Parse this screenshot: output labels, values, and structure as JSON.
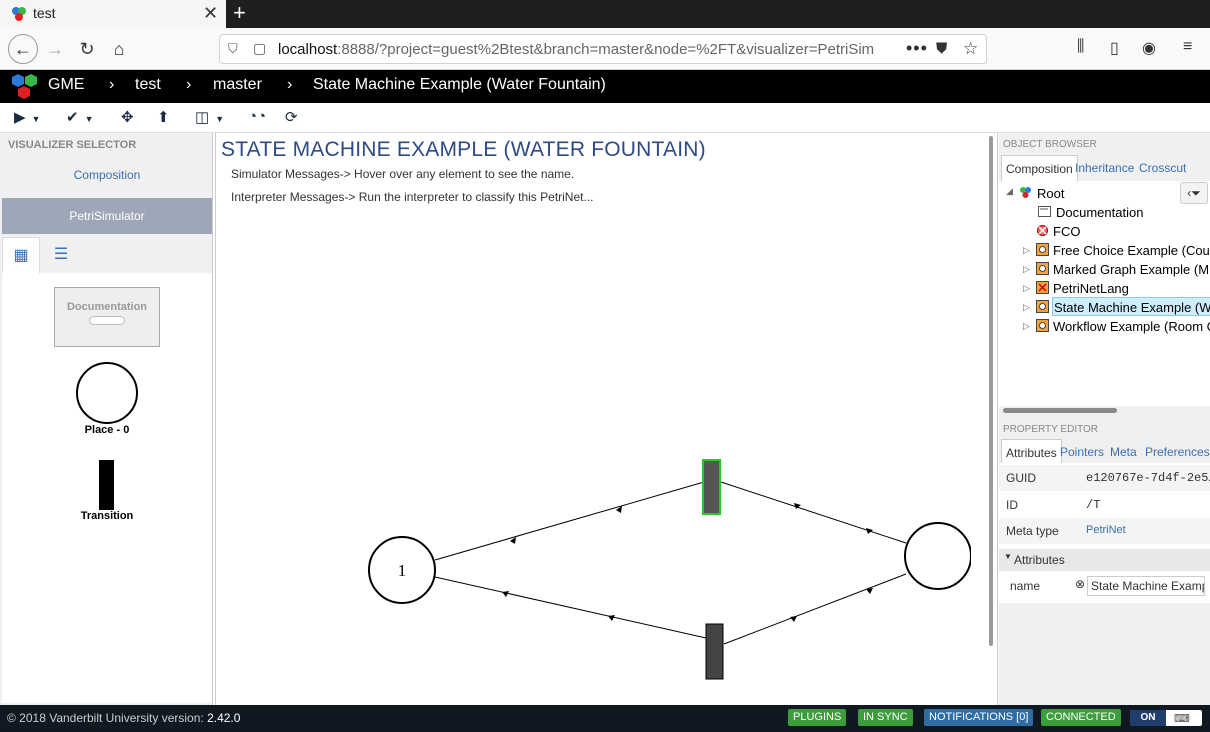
{
  "browser": {
    "tab_title": "test",
    "url_host": "localhost",
    "url_rest": ":8888/?project=guest%2Btest&branch=master&node=%2FT&visualizer=PetriSim"
  },
  "header": {
    "brand": "GME",
    "crumbs": [
      "test",
      "master",
      "State Machine Example (Water Fountain)"
    ]
  },
  "visualizer_selector": {
    "title": "VISUALIZER SELECTOR",
    "items": [
      "Composition",
      "PetriSimulator"
    ]
  },
  "palette": {
    "documentation": "Documentation",
    "place": "Place - 0",
    "transition": "Transition"
  },
  "canvas": {
    "title": "STATE MACHINE EXAMPLE (WATER FOUNTAIN)",
    "simulator_msg": "Simulator Messages-> Hover over any element to see the name.",
    "interpreter_msg": "Interpreter Messages-> Run the interpreter to classify this PetriNet...",
    "token_count": "1"
  },
  "object_browser": {
    "title": "OBJECT BROWSER",
    "tabs": [
      "Composition",
      "Inheritance",
      "Crosscut"
    ],
    "tree": [
      {
        "label": "Root"
      },
      {
        "label": "Documentation"
      },
      {
        "label": "FCO"
      },
      {
        "label": "Free Choice Example (Cou"
      },
      {
        "label": "Marked Graph Example (M"
      },
      {
        "label": "PetriNetLang"
      },
      {
        "label": "State Machine Example (W"
      },
      {
        "label": "Workflow Example (Room C"
      }
    ]
  },
  "property_editor": {
    "title": "PROPERTY EDITOR",
    "tabs": [
      "Attributes",
      "Pointers",
      "Meta",
      "Preferences"
    ],
    "guid_label": "GUID",
    "guid_value": "e120767e-7d4f-2e5…",
    "id_label": "ID",
    "id_value": "/T",
    "metatype_label": "Meta type",
    "metatype_value": "PetriNet",
    "group_label": "Attributes",
    "name_label": "name",
    "name_value": "State Machine Examp"
  },
  "footer": {
    "copyright": "© 2018 Vanderbilt University",
    "version_label": "version:",
    "version": "2.42.0",
    "plugins": "PLUGINS",
    "in_sync": "IN SYNC",
    "notifications": "NOTIFICATIONS [0]",
    "connected": "CONNECTED",
    "on": "ON"
  },
  "colors": {
    "header_bg": "#000000",
    "footer_bg": "#101822",
    "accent": "#3a6fb5",
    "title_blue": "#2c4a86",
    "enabled_transition": "#22cc22"
  }
}
